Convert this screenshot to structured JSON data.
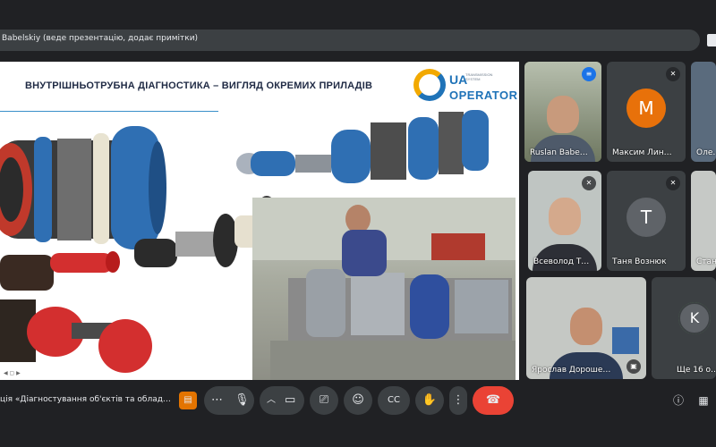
{
  "header": {
    "presenter_text": "Babelskiy (веде презентацію, додає примітки)"
  },
  "slide": {
    "title": "ВНУТРІШНЬОТРУБНА ДІАГНОСТИКА – ВИГЛЯД ОКРЕМИХ ПРИЛАДІВ",
    "logo": {
      "mark": "UA",
      "sub": "TRANSMISSION SYSTEM",
      "word": "OPERATOR"
    }
  },
  "participants": [
    {
      "name": "Ruslan Babe…",
      "type": "video"
    },
    {
      "name": "Максим Лин…",
      "type": "avatar",
      "initial": "M",
      "color": "#e8710a"
    },
    {
      "name": "Оле…",
      "type": "video"
    },
    {
      "name": "Всеволод Т…",
      "type": "video"
    },
    {
      "name": "Таня Вознюк",
      "type": "avatar",
      "initial": "T",
      "color": "#5f6368"
    },
    {
      "name": "Стан…",
      "type": "video"
    },
    {
      "name": "Ярослав Дороше…",
      "type": "video"
    },
    {
      "name": "Ще 16 о…",
      "type": "more",
      "initial": "K"
    }
  ],
  "bottombar": {
    "meeting_title": "ція «Діагностування об'єктів та облад…",
    "icons": [
      "doc-icon",
      "more-options-icon",
      "mic-icon",
      "chevron-up-icon",
      "camera-icon",
      "present-icon",
      "emoji-icon",
      "captions-icon",
      "raise-hand-icon",
      "more-vert-icon",
      "end-call-icon",
      "info-icon",
      "chat-icon"
    ]
  },
  "colors": {
    "background": "#202124",
    "bar": "#3c4043",
    "end_call": "#ea4335",
    "accent_blue": "#1f73b8"
  }
}
